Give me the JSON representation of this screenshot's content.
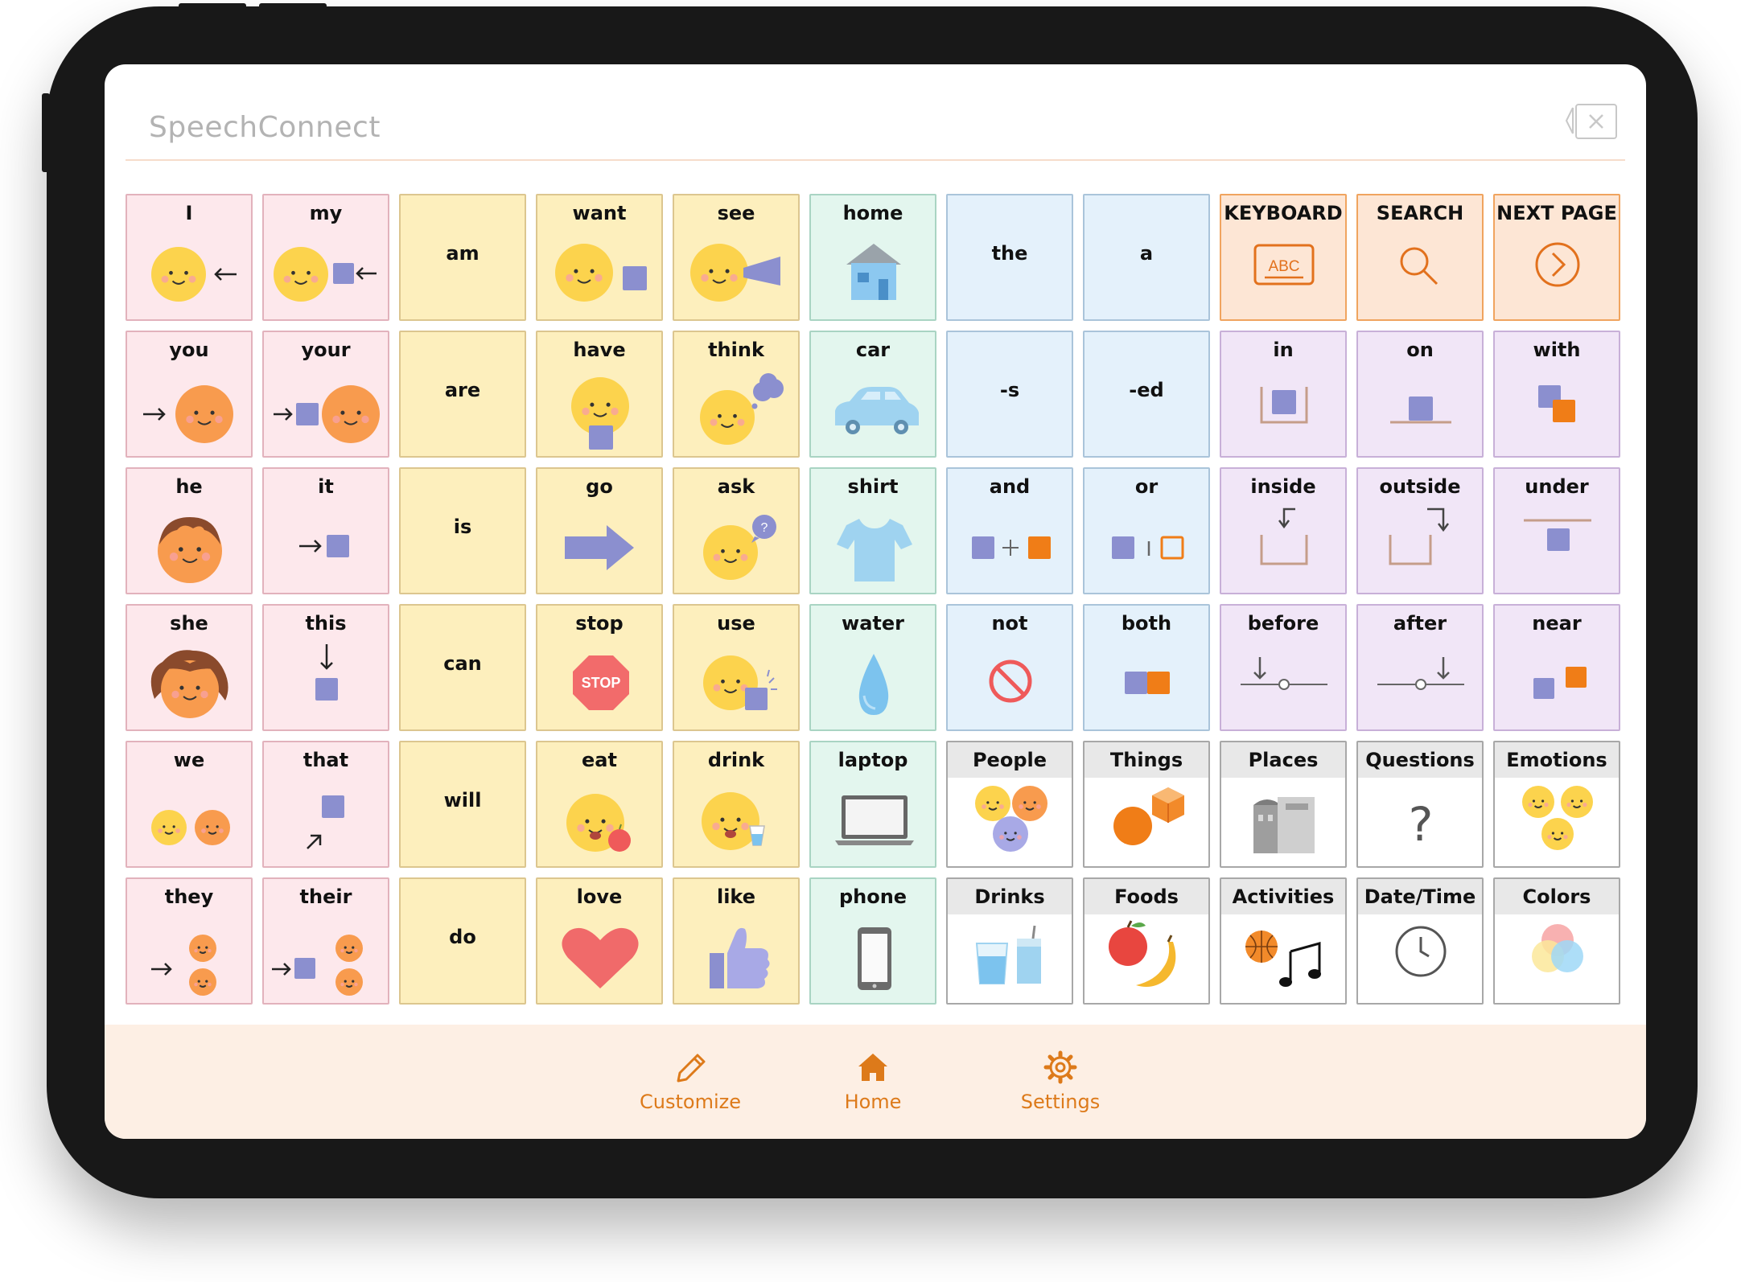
{
  "app": {
    "title": "SpeechConnect"
  },
  "grid": {
    "rows": [
      [
        {
          "label": "I",
          "icon": "face-pointing-self-icon",
          "color": "pink"
        },
        {
          "label": "my",
          "icon": "face-with-own-item-icon",
          "color": "pink"
        },
        {
          "label": "am",
          "icon": "",
          "color": "yellow"
        },
        {
          "label": "want",
          "icon": "face-wanting-item-icon",
          "color": "yellow"
        },
        {
          "label": "see",
          "icon": "face-seeing-icon",
          "color": "yellow"
        },
        {
          "label": "home",
          "icon": "house-icon",
          "color": "green"
        },
        {
          "label": "the",
          "icon": "",
          "color": "blue"
        },
        {
          "label": "a",
          "icon": "",
          "color": "blue"
        },
        {
          "label": "KEYBOARD",
          "icon": "keyboard-abc-icon",
          "color": "orange"
        },
        {
          "label": "SEARCH",
          "icon": "magnifier-icon",
          "color": "orange"
        },
        {
          "label": "NEXT PAGE",
          "icon": "next-page-arrow-icon",
          "color": "orange"
        }
      ],
      [
        {
          "label": "you",
          "icon": "arrow-to-face-icon",
          "color": "pink"
        },
        {
          "label": "your",
          "icon": "arrow-to-item-face-icon",
          "color": "pink"
        },
        {
          "label": "are",
          "icon": "",
          "color": "yellow"
        },
        {
          "label": "have",
          "icon": "face-holding-item-icon",
          "color": "yellow"
        },
        {
          "label": "think",
          "icon": "face-thinking-icon",
          "color": "yellow"
        },
        {
          "label": "car",
          "icon": "car-icon",
          "color": "green"
        },
        {
          "label": "-s",
          "icon": "",
          "color": "blue"
        },
        {
          "label": "-ed",
          "icon": "",
          "color": "blue"
        },
        {
          "label": "in",
          "icon": "item-in-container-icon",
          "color": "purple"
        },
        {
          "label": "on",
          "icon": "item-on-surface-icon",
          "color": "purple"
        },
        {
          "label": "with",
          "icon": "two-items-together-icon",
          "color": "purple"
        }
      ],
      [
        {
          "label": "he",
          "icon": "boy-face-icon",
          "color": "pink"
        },
        {
          "label": "it",
          "icon": "arrow-to-item-icon",
          "color": "pink"
        },
        {
          "label": "is",
          "icon": "",
          "color": "yellow"
        },
        {
          "label": "go",
          "icon": "right-arrow-icon",
          "color": "yellow"
        },
        {
          "label": "ask",
          "icon": "face-asking-icon",
          "color": "yellow"
        },
        {
          "label": "shirt",
          "icon": "shirt-icon",
          "color": "green"
        },
        {
          "label": "and",
          "icon": "item-plus-item-icon",
          "color": "blue"
        },
        {
          "label": "or",
          "icon": "item-or-item-icon",
          "color": "blue"
        },
        {
          "label": "inside",
          "icon": "arrow-into-box-icon",
          "color": "purple"
        },
        {
          "label": "outside",
          "icon": "arrow-outside-box-icon",
          "color": "purple"
        },
        {
          "label": "under",
          "icon": "item-under-line-icon",
          "color": "purple"
        }
      ],
      [
        {
          "label": "she",
          "icon": "girl-face-icon",
          "color": "pink"
        },
        {
          "label": "this",
          "icon": "arrow-down-to-item-icon",
          "color": "pink"
        },
        {
          "label": "can",
          "icon": "",
          "color": "yellow"
        },
        {
          "label": "stop",
          "icon": "stop-sign-icon",
          "color": "yellow"
        },
        {
          "label": "use",
          "icon": "face-using-item-icon",
          "color": "yellow"
        },
        {
          "label": "water",
          "icon": "water-drop-icon",
          "color": "green"
        },
        {
          "label": "not",
          "icon": "prohibited-icon",
          "color": "blue"
        },
        {
          "label": "both",
          "icon": "two-items-icon",
          "color": "blue"
        },
        {
          "label": "before",
          "icon": "timeline-before-icon",
          "color": "purple"
        },
        {
          "label": "after",
          "icon": "timeline-after-icon",
          "color": "purple"
        },
        {
          "label": "near",
          "icon": "items-near-icon",
          "color": "purple"
        }
      ],
      [
        {
          "label": "we",
          "icon": "two-faces-icon",
          "color": "pink"
        },
        {
          "label": "that",
          "icon": "arrow-to-far-item-icon",
          "color": "pink"
        },
        {
          "label": "will",
          "icon": "",
          "color": "yellow"
        },
        {
          "label": "eat",
          "icon": "face-eating-icon",
          "color": "yellow"
        },
        {
          "label": "drink",
          "icon": "face-drinking-icon",
          "color": "yellow"
        },
        {
          "label": "laptop",
          "icon": "laptop-icon",
          "color": "green"
        },
        {
          "label": "People",
          "icon": "people-faces-icon",
          "color": "category"
        },
        {
          "label": "Things",
          "icon": "objects-icon",
          "color": "category"
        },
        {
          "label": "Places",
          "icon": "buildings-icon",
          "color": "category"
        },
        {
          "label": "Questions",
          "icon": "question-mark-icon",
          "color": "category"
        },
        {
          "label": "Emotions",
          "icon": "emotion-faces-icon",
          "color": "category"
        }
      ],
      [
        {
          "label": "they",
          "icon": "arrow-to-group-icon",
          "color": "pink"
        },
        {
          "label": "their",
          "icon": "arrow-to-group-item-icon",
          "color": "pink"
        },
        {
          "label": "do",
          "icon": "",
          "color": "yellow"
        },
        {
          "label": "love",
          "icon": "heart-icon",
          "color": "yellow"
        },
        {
          "label": "like",
          "icon": "thumbs-up-icon",
          "color": "yellow"
        },
        {
          "label": "phone",
          "icon": "phone-icon",
          "color": "green"
        },
        {
          "label": "Drinks",
          "icon": "cups-icon",
          "color": "category"
        },
        {
          "label": "Foods",
          "icon": "apple-banana-icon",
          "color": "category"
        },
        {
          "label": "Activities",
          "icon": "ball-music-icon",
          "color": "category"
        },
        {
          "label": "Date/Time",
          "icon": "clock-icon",
          "color": "category"
        },
        {
          "label": "Colors",
          "icon": "color-circles-icon",
          "color": "category"
        }
      ]
    ]
  },
  "nav": [
    {
      "label": "Customize",
      "icon": "pencil-icon"
    },
    {
      "label": "Home",
      "icon": "home-icon"
    },
    {
      "label": "Settings",
      "icon": "gear-icon"
    }
  ],
  "colors": {
    "pink": "#fde8ec",
    "yellow": "#fdefbd",
    "green": "#e3f6ee",
    "blue": "#e4f1fb",
    "orange": "#fde6d5",
    "purple": "#f1e6f7",
    "category": "#ffffff",
    "accent": "#dd7a1a",
    "face": "#fcd34d",
    "face_orange": "#f89b4e",
    "square": "#8b8fcf"
  }
}
